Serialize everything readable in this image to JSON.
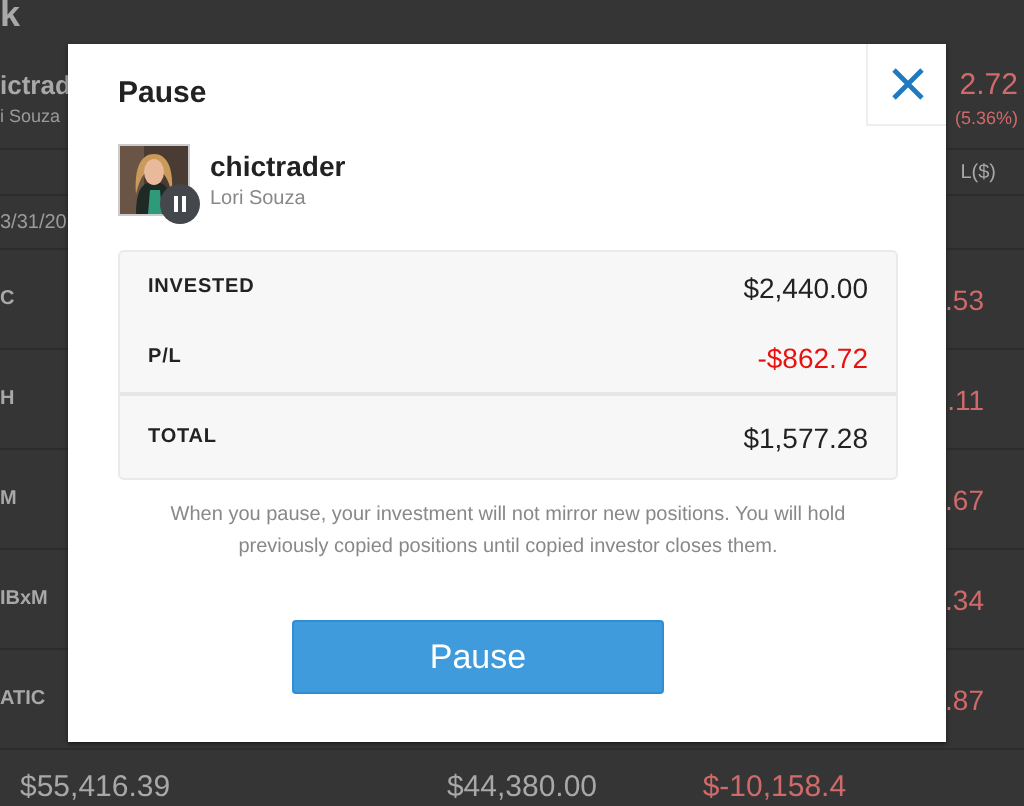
{
  "background": {
    "title": "k",
    "trader": {
      "name": "ictrad",
      "username": "i Souza",
      "profit": "2.72",
      "profit_percent": "(5.36%)"
    },
    "column_header": "L($)",
    "date": "3/31/20",
    "rows": [
      {
        "symbol": "C",
        "value": ".53"
      },
      {
        "symbol": "H",
        "value": ".11"
      },
      {
        "symbol": "M",
        "value": ".67"
      },
      {
        "symbol": "IBxM",
        "value": ".34"
      },
      {
        "symbol": "ATIC",
        "value": ".87"
      }
    ],
    "totals": [
      {
        "value": "$55,416.39",
        "kind": "normal"
      },
      {
        "value": "$44,380.00",
        "kind": "normal"
      },
      {
        "value": "$-10,158.4",
        "kind": "loss"
      }
    ]
  },
  "dialog": {
    "title": "Pause",
    "trader": {
      "name": "chictrader",
      "username": "Lori Souza"
    },
    "summary": [
      {
        "label": "INVESTED",
        "value": "$2,440.00",
        "kind": "normal"
      },
      {
        "label": "P/L",
        "value": "-$862.72",
        "kind": "loss"
      },
      {
        "label": "TOTAL",
        "value": "$1,577.28",
        "kind": "total"
      }
    ],
    "note": "When you pause, your investment will not mirror new positions. You will hold previously copied positions until copied investor closes them.",
    "button": "Pause"
  }
}
